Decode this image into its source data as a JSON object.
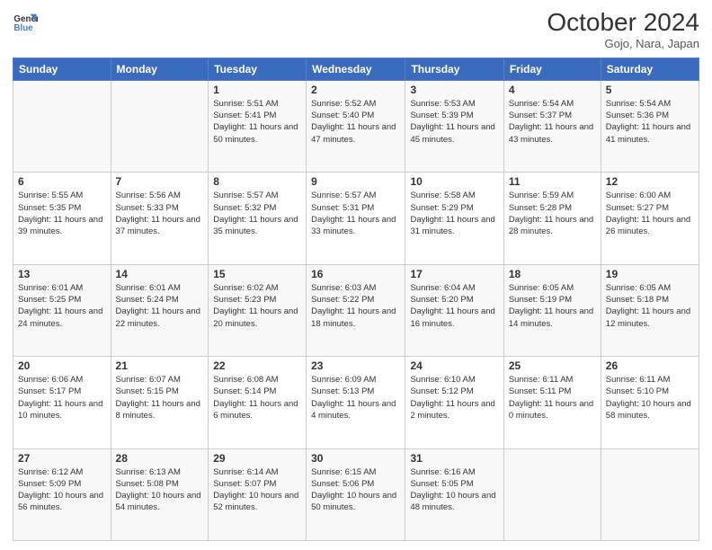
{
  "header": {
    "logo_line1": "General",
    "logo_line2": "Blue",
    "month_year": "October 2024",
    "location": "Gojo, Nara, Japan"
  },
  "weekdays": [
    "Sunday",
    "Monday",
    "Tuesday",
    "Wednesday",
    "Thursday",
    "Friday",
    "Saturday"
  ],
  "weeks": [
    [
      {
        "day": "",
        "info": ""
      },
      {
        "day": "",
        "info": ""
      },
      {
        "day": "1",
        "info": "Sunrise: 5:51 AM\nSunset: 5:41 PM\nDaylight: 11 hours and 50 minutes."
      },
      {
        "day": "2",
        "info": "Sunrise: 5:52 AM\nSunset: 5:40 PM\nDaylight: 11 hours and 47 minutes."
      },
      {
        "day": "3",
        "info": "Sunrise: 5:53 AM\nSunset: 5:39 PM\nDaylight: 11 hours and 45 minutes."
      },
      {
        "day": "4",
        "info": "Sunrise: 5:54 AM\nSunset: 5:37 PM\nDaylight: 11 hours and 43 minutes."
      },
      {
        "day": "5",
        "info": "Sunrise: 5:54 AM\nSunset: 5:36 PM\nDaylight: 11 hours and 41 minutes."
      }
    ],
    [
      {
        "day": "6",
        "info": "Sunrise: 5:55 AM\nSunset: 5:35 PM\nDaylight: 11 hours and 39 minutes."
      },
      {
        "day": "7",
        "info": "Sunrise: 5:56 AM\nSunset: 5:33 PM\nDaylight: 11 hours and 37 minutes."
      },
      {
        "day": "8",
        "info": "Sunrise: 5:57 AM\nSunset: 5:32 PM\nDaylight: 11 hours and 35 minutes."
      },
      {
        "day": "9",
        "info": "Sunrise: 5:57 AM\nSunset: 5:31 PM\nDaylight: 11 hours and 33 minutes."
      },
      {
        "day": "10",
        "info": "Sunrise: 5:58 AM\nSunset: 5:29 PM\nDaylight: 11 hours and 31 minutes."
      },
      {
        "day": "11",
        "info": "Sunrise: 5:59 AM\nSunset: 5:28 PM\nDaylight: 11 hours and 28 minutes."
      },
      {
        "day": "12",
        "info": "Sunrise: 6:00 AM\nSunset: 5:27 PM\nDaylight: 11 hours and 26 minutes."
      }
    ],
    [
      {
        "day": "13",
        "info": "Sunrise: 6:01 AM\nSunset: 5:25 PM\nDaylight: 11 hours and 24 minutes."
      },
      {
        "day": "14",
        "info": "Sunrise: 6:01 AM\nSunset: 5:24 PM\nDaylight: 11 hours and 22 minutes."
      },
      {
        "day": "15",
        "info": "Sunrise: 6:02 AM\nSunset: 5:23 PM\nDaylight: 11 hours and 20 minutes."
      },
      {
        "day": "16",
        "info": "Sunrise: 6:03 AM\nSunset: 5:22 PM\nDaylight: 11 hours and 18 minutes."
      },
      {
        "day": "17",
        "info": "Sunrise: 6:04 AM\nSunset: 5:20 PM\nDaylight: 11 hours and 16 minutes."
      },
      {
        "day": "18",
        "info": "Sunrise: 6:05 AM\nSunset: 5:19 PM\nDaylight: 11 hours and 14 minutes."
      },
      {
        "day": "19",
        "info": "Sunrise: 6:05 AM\nSunset: 5:18 PM\nDaylight: 11 hours and 12 minutes."
      }
    ],
    [
      {
        "day": "20",
        "info": "Sunrise: 6:06 AM\nSunset: 5:17 PM\nDaylight: 11 hours and 10 minutes."
      },
      {
        "day": "21",
        "info": "Sunrise: 6:07 AM\nSunset: 5:15 PM\nDaylight: 11 hours and 8 minutes."
      },
      {
        "day": "22",
        "info": "Sunrise: 6:08 AM\nSunset: 5:14 PM\nDaylight: 11 hours and 6 minutes."
      },
      {
        "day": "23",
        "info": "Sunrise: 6:09 AM\nSunset: 5:13 PM\nDaylight: 11 hours and 4 minutes."
      },
      {
        "day": "24",
        "info": "Sunrise: 6:10 AM\nSunset: 5:12 PM\nDaylight: 11 hours and 2 minutes."
      },
      {
        "day": "25",
        "info": "Sunrise: 6:11 AM\nSunset: 5:11 PM\nDaylight: 11 hours and 0 minutes."
      },
      {
        "day": "26",
        "info": "Sunrise: 6:11 AM\nSunset: 5:10 PM\nDaylight: 10 hours and 58 minutes."
      }
    ],
    [
      {
        "day": "27",
        "info": "Sunrise: 6:12 AM\nSunset: 5:09 PM\nDaylight: 10 hours and 56 minutes."
      },
      {
        "day": "28",
        "info": "Sunrise: 6:13 AM\nSunset: 5:08 PM\nDaylight: 10 hours and 54 minutes."
      },
      {
        "day": "29",
        "info": "Sunrise: 6:14 AM\nSunset: 5:07 PM\nDaylight: 10 hours and 52 minutes."
      },
      {
        "day": "30",
        "info": "Sunrise: 6:15 AM\nSunset: 5:06 PM\nDaylight: 10 hours and 50 minutes."
      },
      {
        "day": "31",
        "info": "Sunrise: 6:16 AM\nSunset: 5:05 PM\nDaylight: 10 hours and 48 minutes."
      },
      {
        "day": "",
        "info": ""
      },
      {
        "day": "",
        "info": ""
      }
    ]
  ]
}
